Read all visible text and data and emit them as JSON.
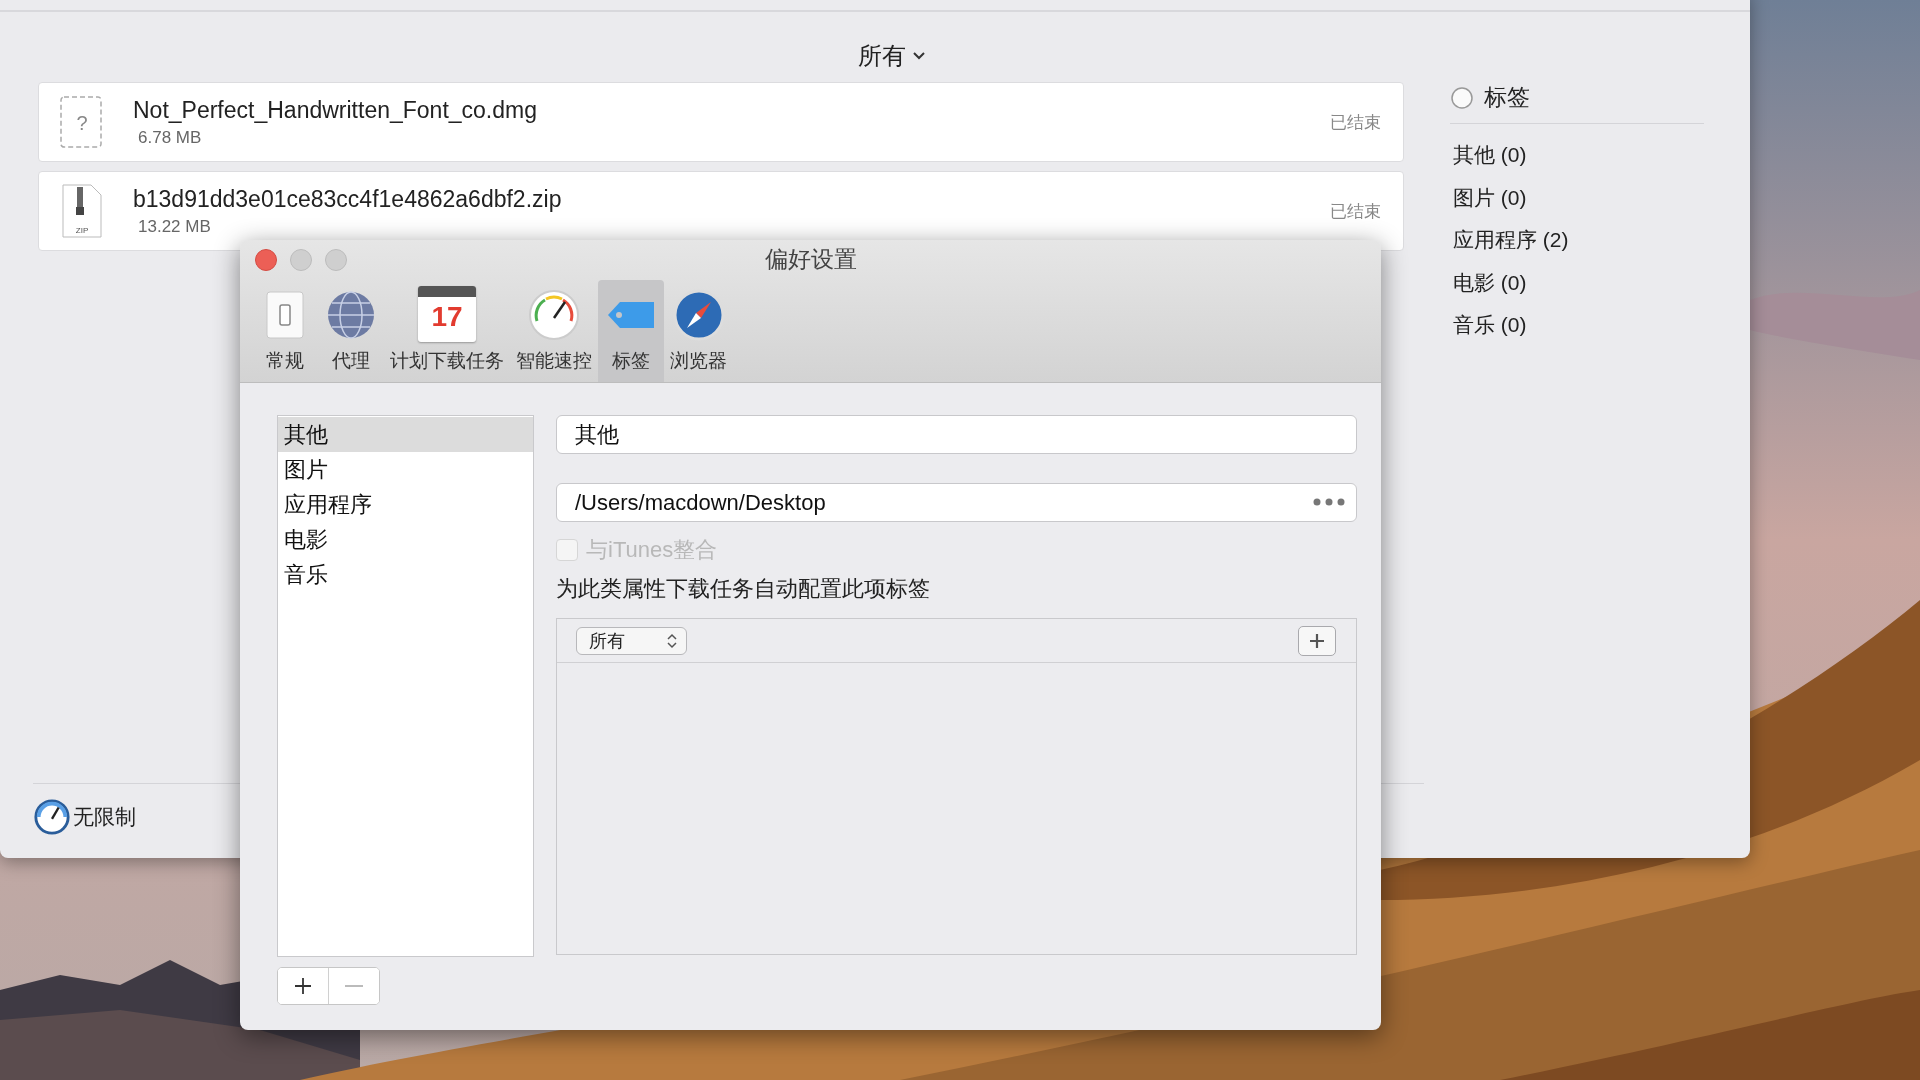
{
  "main_window": {
    "filter": {
      "label": "所有"
    },
    "downloads": [
      {
        "kind": "unknown",
        "name": "Not_Perfect_Handwritten_Font_co.dmg",
        "size": "6.78 MB",
        "status": "已结束",
        "file_badge": "?"
      },
      {
        "kind": "zip",
        "name": "b13d91dd3e01ce83cc4f1e4862a6dbf2.zip",
        "size": "13.22 MB",
        "status": "已结束",
        "file_badge": "ZIP"
      }
    ],
    "sidebar": {
      "heading": "标签",
      "items": [
        {
          "label": "其他 (0)"
        },
        {
          "label": "图片 (0)"
        },
        {
          "label": "应用程序 (2)"
        },
        {
          "label": "电影 (0)"
        },
        {
          "label": "音乐 (0)"
        }
      ]
    },
    "speed_limit": "无限制"
  },
  "preferences": {
    "title": "偏好设置",
    "toolbar": [
      {
        "kind": "switch",
        "label": "常规",
        "selected": false
      },
      {
        "kind": "globe",
        "label": "代理",
        "selected": false
      },
      {
        "kind": "calendar",
        "label": "计划下载任务",
        "selected": false,
        "badge": "17"
      },
      {
        "kind": "gauge",
        "label": "智能速控",
        "selected": false
      },
      {
        "kind": "tag",
        "label": "标签",
        "selected": true
      },
      {
        "kind": "compass",
        "label": "浏览器",
        "selected": false
      }
    ],
    "categories": [
      {
        "label": "其他",
        "selected": true
      },
      {
        "label": "图片",
        "selected": false
      },
      {
        "label": "应用程序",
        "selected": false
      },
      {
        "label": "电影",
        "selected": false
      },
      {
        "label": "音乐",
        "selected": false
      }
    ],
    "name_field": {
      "value": "其他"
    },
    "path_field": {
      "value": "/Users/macdown/Desktop"
    },
    "itunes": {
      "label": "与iTunes整合",
      "checked": false,
      "disabled": true
    },
    "rules_heading": "为此类属性下载任务自动配置此项标签",
    "rule_popup": {
      "value": "所有"
    }
  }
}
